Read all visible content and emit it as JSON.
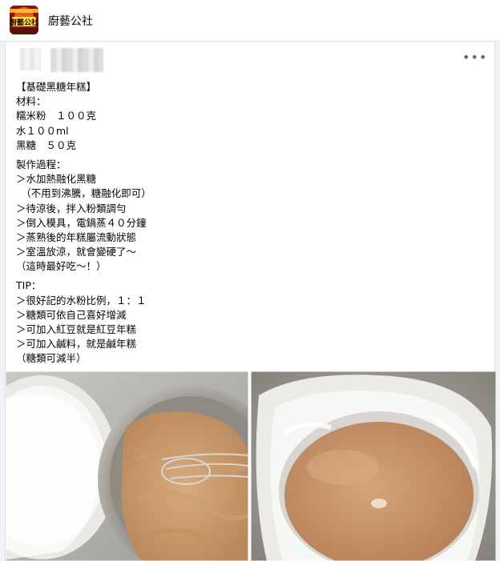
{
  "group": {
    "name": "廚藝公社",
    "logo_text": "廚藝公社"
  },
  "post": {
    "more_icon": "more-horizontal-icon",
    "body_lines": [
      "【基礎黑糖年糕】",
      "材料：",
      "糯米粉　１００克",
      "水１００ml",
      "黑糖　５０克",
      "",
      "製作過程：",
      "＞水加熱融化黑糖",
      "　（不用到沸騰，糖融化即可）",
      "＞待涼後，拌入粉類調勻",
      "＞倒入模具，電鍋蒸４０分鐘",
      "＞蒸熟後的年糕屬流動狀態",
      "＞室溫放涼，就會變硬了～",
      "（這時最好吃～！）",
      "",
      "TIP：",
      "＞很好記的水粉比例，１：１",
      "＞糖類可依自己喜好增減",
      "＞可加入紅豆就是紅豆年糕",
      "＞可加入鹹料，就是鹹年糕",
      "（糖類可減半）"
    ]
  },
  "photos": [
    {
      "name": "batter-mixing-photo"
    },
    {
      "name": "steamed-cake-photo"
    }
  ]
}
